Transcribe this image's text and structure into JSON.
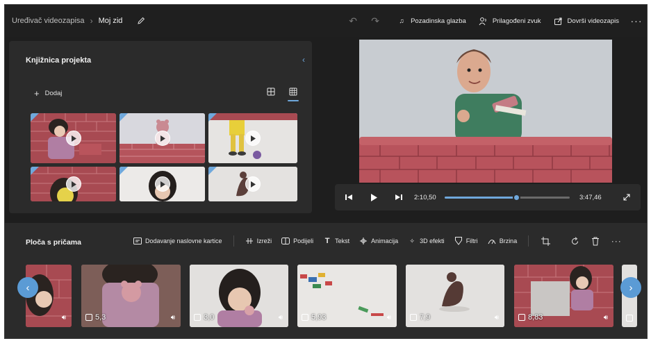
{
  "window": {
    "app_title": "Uređivač videozapisa",
    "project_name": "Moj zid",
    "actions": {
      "background_music": "Pozadinska glazba",
      "custom_audio": "Prilagođeni zvuk",
      "finish_video": "Dovrši videozapis"
    }
  },
  "library": {
    "title": "Knjižnica projekta",
    "add_label": "Dodaj"
  },
  "player": {
    "current_time": "2:10,50",
    "total_time": "3:47,46",
    "progress": 0.57
  },
  "storyboard": {
    "title": "Ploča s pričama",
    "tools": {
      "add_title_card": "Dodavanje naslovne kartice",
      "trim": "Izreži",
      "split": "Podijeli",
      "text": "Tekst",
      "animation": "Animacija",
      "effects_3d": "3D efekti",
      "filters": "Filtri",
      "speed": "Brzina"
    },
    "clips": [
      {
        "duration": ""
      },
      {
        "duration": "5,3"
      },
      {
        "duration": "3,0"
      },
      {
        "duration": "5,93"
      },
      {
        "duration": "7,9"
      },
      {
        "duration": "8,83"
      },
      {
        "duration": ""
      }
    ]
  },
  "colors": {
    "accent": "#6fa8dc",
    "background": "#1e1e1e",
    "panel": "#2b2b2b",
    "brick": "#b9545c"
  }
}
